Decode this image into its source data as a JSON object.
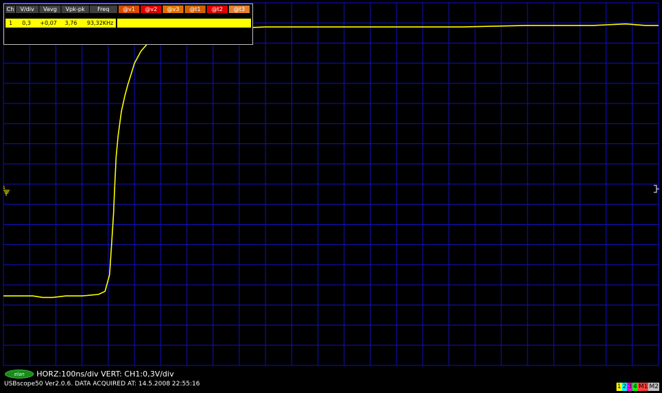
{
  "window": {
    "title": "USBscope50"
  },
  "measurements": {
    "headers": {
      "ch": "Ch",
      "vdiv": "V/div",
      "vavg": "Vavg",
      "vpkpk": "Vpk-pk",
      "freq": "Freq",
      "cursors": [
        "@v1",
        "@v2",
        "@v3",
        "@t1",
        "@t2",
        "@t3"
      ]
    },
    "cursor_colors": [
      "#d84a00",
      "#e00000",
      "#e07000",
      "#d06000",
      "#e00000",
      "#e08030"
    ],
    "row": {
      "ch": "1",
      "vdiv": "0,3",
      "vavg": "+0,07",
      "vpkpk": "3,76",
      "freq": "93,32KHz"
    }
  },
  "status": {
    "logo_text": "elan",
    "horz_vert": "HORZ:100ns/div VERT: CH1:0,3V/div",
    "acquired": "USBscope50 Ver2.0.6.  DATA ACQUIRED AT: 14.5.2008 22:55:16"
  },
  "channel_selector": {
    "items": [
      {
        "label": "1",
        "color": "#ffff00"
      },
      {
        "label": "2",
        "color": "#00ffff"
      },
      {
        "label": "3",
        "color": "#ff00ff"
      },
      {
        "label": "4",
        "color": "#00ff00"
      },
      {
        "label": "M1",
        "color": "#ff4040"
      },
      {
        "label": "M2",
        "color": "#c0c0c0"
      }
    ]
  },
  "colors": {
    "grid": "#1010c8",
    "trace": "#ffff00",
    "background": "#000000"
  },
  "chart_data": {
    "type": "line",
    "title": "",
    "xlabel": "",
    "ylabel": "",
    "xlim": [
      0,
      1000
    ],
    "ylim": [
      -1.2,
      1.2
    ],
    "grid": true,
    "series": [
      {
        "x": [
          0,
          45,
          60,
          75,
          95,
          120,
          145,
          155,
          162,
          165,
          168,
          170,
          172,
          175,
          180,
          185,
          190,
          195,
          200,
          210,
          220,
          235,
          250,
          260,
          270,
          285,
          300,
          340,
          400,
          500,
          600,
          700,
          800,
          860,
          900,
          950,
          980,
          1000
        ],
        "y": [
          -0.74,
          -0.74,
          -0.75,
          -0.75,
          -0.74,
          -0.74,
          -0.73,
          -0.71,
          -0.6,
          -0.4,
          -0.2,
          0.0,
          0.18,
          0.32,
          0.48,
          0.58,
          0.66,
          0.73,
          0.8,
          0.88,
          0.93,
          0.97,
          1.0,
          1.01,
          1.02,
          1.03,
          1.03,
          1.03,
          1.04,
          1.04,
          1.04,
          1.04,
          1.05,
          1.05,
          1.05,
          1.06,
          1.05,
          1.05
        ]
      }
    ]
  }
}
